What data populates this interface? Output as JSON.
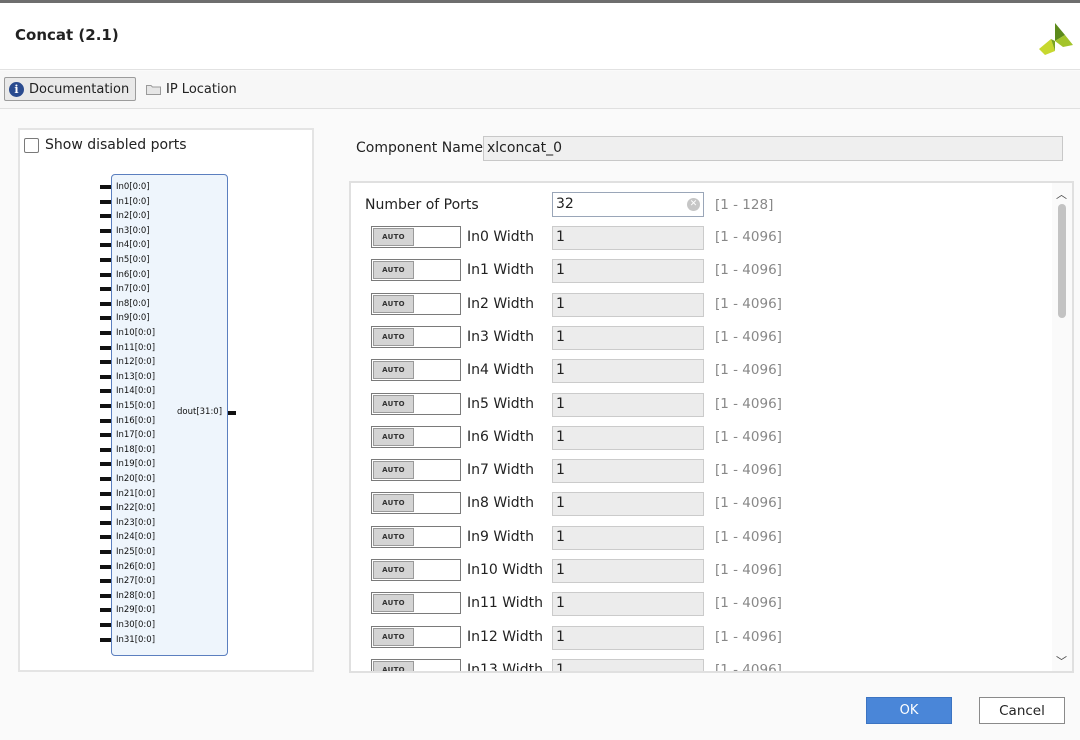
{
  "dialog": {
    "title": "Concat (2.1)"
  },
  "toolbar": {
    "documentation_label": "Documentation",
    "ip_location_label": "IP Location"
  },
  "symbol_panel": {
    "show_disabled_label": "Show disabled ports",
    "show_disabled_checked": false,
    "input_ports": [
      "In0[0:0]",
      "In1[0:0]",
      "In2[0:0]",
      "In3[0:0]",
      "In4[0:0]",
      "In5[0:0]",
      "In6[0:0]",
      "In7[0:0]",
      "In8[0:0]",
      "In9[0:0]",
      "In10[0:0]",
      "In11[0:0]",
      "In12[0:0]",
      "In13[0:0]",
      "In14[0:0]",
      "In15[0:0]",
      "In16[0:0]",
      "In17[0:0]",
      "In18[0:0]",
      "In19[0:0]",
      "In20[0:0]",
      "In21[0:0]",
      "In22[0:0]",
      "In23[0:0]",
      "In24[0:0]",
      "In25[0:0]",
      "In26[0:0]",
      "In27[0:0]",
      "In28[0:0]",
      "In29[0:0]",
      "In30[0:0]",
      "In31[0:0]"
    ],
    "output_port": "dout[31:0]"
  },
  "component": {
    "label": "Component Name",
    "value": "xlconcat_0"
  },
  "params": {
    "num_ports": {
      "label": "Number of Ports",
      "value": "32",
      "range": "[1 - 128]"
    },
    "toggle_label": "AUTO",
    "widths": [
      {
        "label": "In0 Width",
        "value": "1",
        "range": "[1 - 4096]"
      },
      {
        "label": "In1 Width",
        "value": "1",
        "range": "[1 - 4096]"
      },
      {
        "label": "In2 Width",
        "value": "1",
        "range": "[1 - 4096]"
      },
      {
        "label": "In3 Width",
        "value": "1",
        "range": "[1 - 4096]"
      },
      {
        "label": "In4 Width",
        "value": "1",
        "range": "[1 - 4096]"
      },
      {
        "label": "In5 Width",
        "value": "1",
        "range": "[1 - 4096]"
      },
      {
        "label": "In6 Width",
        "value": "1",
        "range": "[1 - 4096]"
      },
      {
        "label": "In7 Width",
        "value": "1",
        "range": "[1 - 4096]"
      },
      {
        "label": "In8 Width",
        "value": "1",
        "range": "[1 - 4096]"
      },
      {
        "label": "In9 Width",
        "value": "1",
        "range": "[1 - 4096]"
      },
      {
        "label": "In10 Width",
        "value": "1",
        "range": "[1 - 4096]"
      },
      {
        "label": "In11 Width",
        "value": "1",
        "range": "[1 - 4096]"
      },
      {
        "label": "In12 Width",
        "value": "1",
        "range": "[1 - 4096]"
      },
      {
        "label": "In13 Width",
        "value": "1",
        "range": "[1 - 4096]"
      }
    ]
  },
  "buttons": {
    "ok": "OK",
    "cancel": "Cancel"
  }
}
